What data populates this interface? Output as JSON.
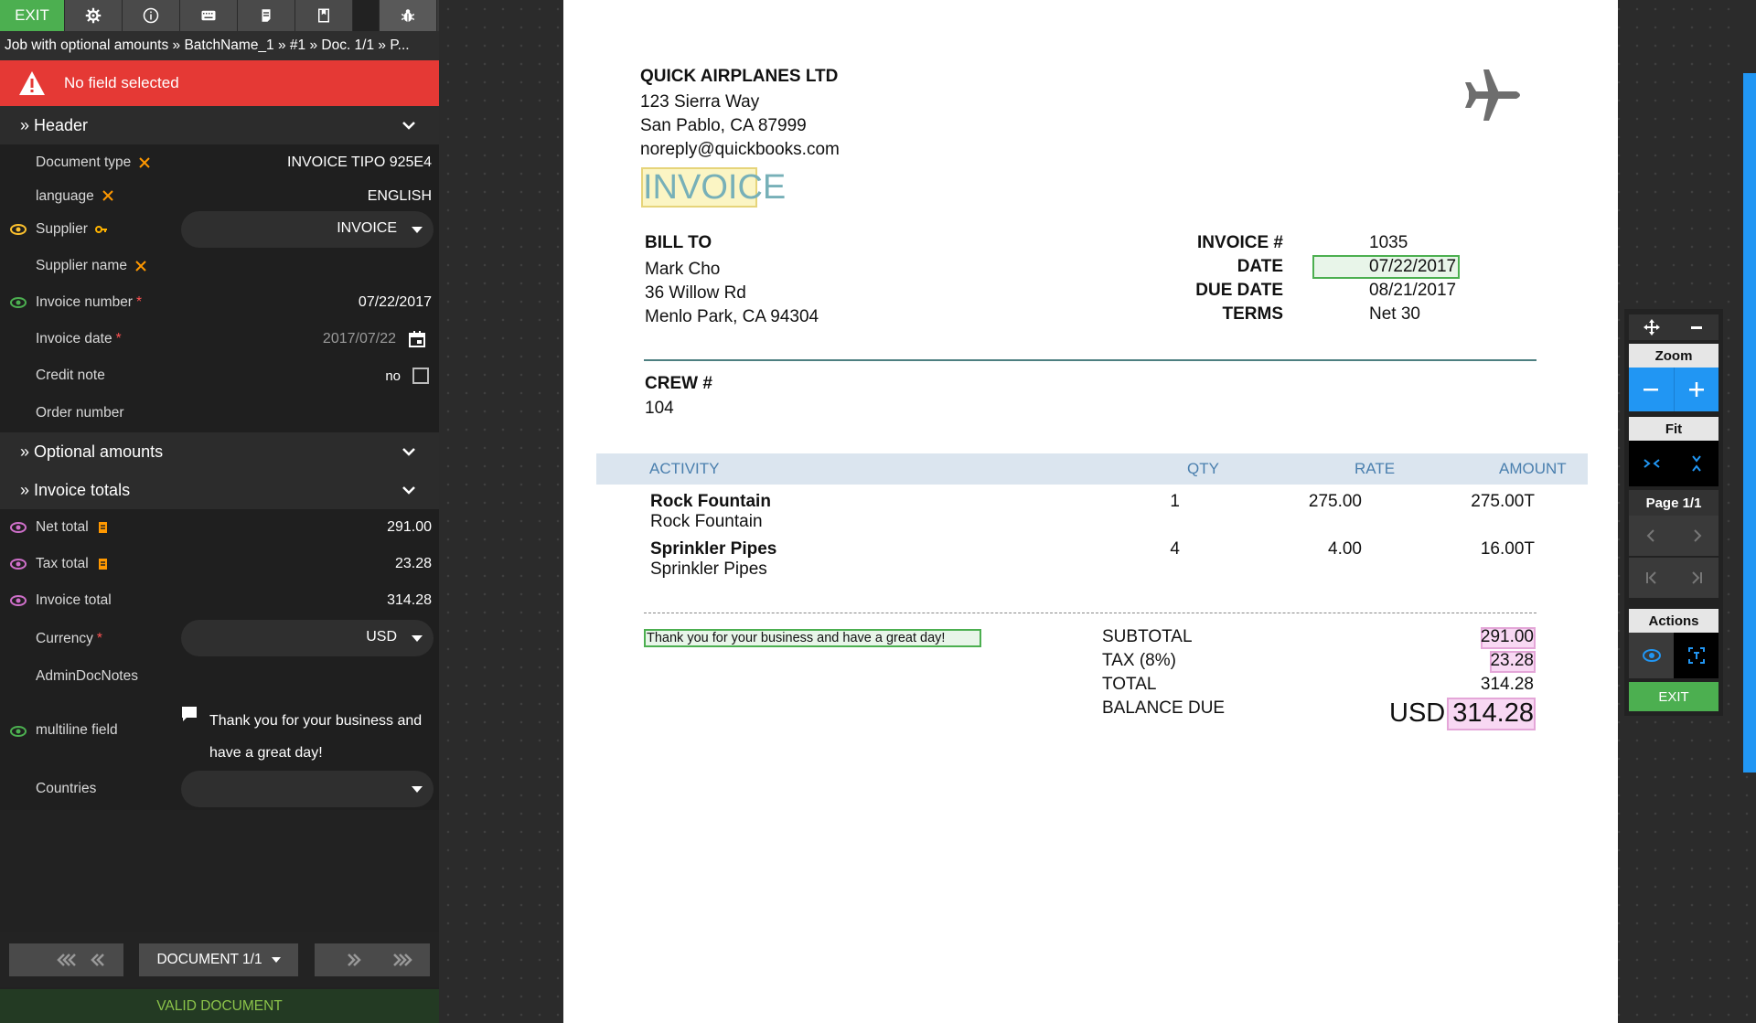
{
  "toolbar": {
    "exit_label": "EXIT",
    "icons": [
      "gear-icon",
      "info-icon",
      "keyboard-icon",
      "document-edit-icon",
      "bookmark-icon",
      "bug-icon"
    ]
  },
  "breadcrumb": "Job with optional amounts » BatchName_1 » #1 » Doc. 1/1 » P...",
  "alert": {
    "text": "No field selected",
    "color": "#e53935"
  },
  "sections": {
    "header": "Header",
    "optional_amounts": "Optional amounts",
    "invoice_totals": "Invoice totals"
  },
  "fields": {
    "document_type": {
      "label": "Document type",
      "value": "INVOICE TIPO 925E4"
    },
    "language": {
      "label": "language",
      "value": "ENGLISH"
    },
    "supplier": {
      "label": "Supplier",
      "value": "INVOICE"
    },
    "supplier_name": {
      "label": "Supplier name",
      "value": ""
    },
    "invoice_number": {
      "label": "Invoice number",
      "required": "*",
      "value": "07/22/2017"
    },
    "invoice_date": {
      "label": "Invoice date",
      "required": "*",
      "value": "2017/07/22"
    },
    "credit_note": {
      "label": "Credit note",
      "value": "no"
    },
    "order_number": {
      "label": "Order number",
      "value": ""
    },
    "net_total": {
      "label": "Net total",
      "value": "291.00"
    },
    "tax_total": {
      "label": "Tax total",
      "value": "23.28"
    },
    "invoice_total": {
      "label": "Invoice total",
      "value": "314.28"
    },
    "currency": {
      "label": "Currency",
      "required": "*",
      "value": "USD"
    },
    "admin_doc_notes": {
      "label": "AdminDocNotes",
      "value": ""
    },
    "multiline": {
      "label": "multiline field",
      "value": "Thank you for your business and have a great day!"
    },
    "countries": {
      "label": "Countries",
      "value": ""
    }
  },
  "nav": {
    "document_selector": "DOCUMENT 1/1",
    "status": "VALID DOCUMENT"
  },
  "document": {
    "company": "QUICK AIRPLANES LTD",
    "address_lines": [
      "123 Sierra Way",
      "San Pablo, CA  87999",
      "noreply@quickbooks.com"
    ],
    "title": "INVOICE",
    "bill_to_label": "BILL TO",
    "bill_to_lines": [
      "Mark Cho",
      "36 Willow Rd",
      "Menlo Park, CA  94304"
    ],
    "invoice_no_label": "INVOICE #",
    "invoice_no": "1035",
    "date_label": "DATE",
    "date": "07/22/2017",
    "due_date_label": "DUE DATE",
    "due_date": "08/21/2017",
    "terms_label": "TERMS",
    "terms": "Net 30",
    "crew_label": "CREW #",
    "crew": "104",
    "table_headers": [
      "ACTIVITY",
      "QTY",
      "RATE",
      "AMOUNT"
    ],
    "rows": [
      {
        "item": "Rock Fountain",
        "desc": "Rock Fountain",
        "qty": "1",
        "rate": "275.00",
        "amount": "275.00T"
      },
      {
        "item": "Sprinkler Pipes",
        "desc": "Sprinkler Pipes",
        "qty": "4",
        "rate": "4.00",
        "amount": "16.00T"
      }
    ],
    "thanks": "Thank you for your business and have a great day!",
    "subtotal_label": "SUBTOTAL",
    "subtotal": "291.00",
    "tax_label": "TAX (8%)",
    "tax": "23.28",
    "total_label": "TOTAL",
    "total": "314.28",
    "balance_label": "BALANCE DUE",
    "balance_currency": "USD",
    "balance": "314.28"
  },
  "controls": {
    "zoom_label": "Zoom",
    "fit_label": "Fit",
    "page_label": "Page 1/1",
    "actions_label": "Actions",
    "exit_label": "EXIT"
  },
  "colors": {
    "accent_blue": "#2196f3",
    "green": "#4caf50",
    "red": "#e53935",
    "orange": "#ff9800"
  }
}
